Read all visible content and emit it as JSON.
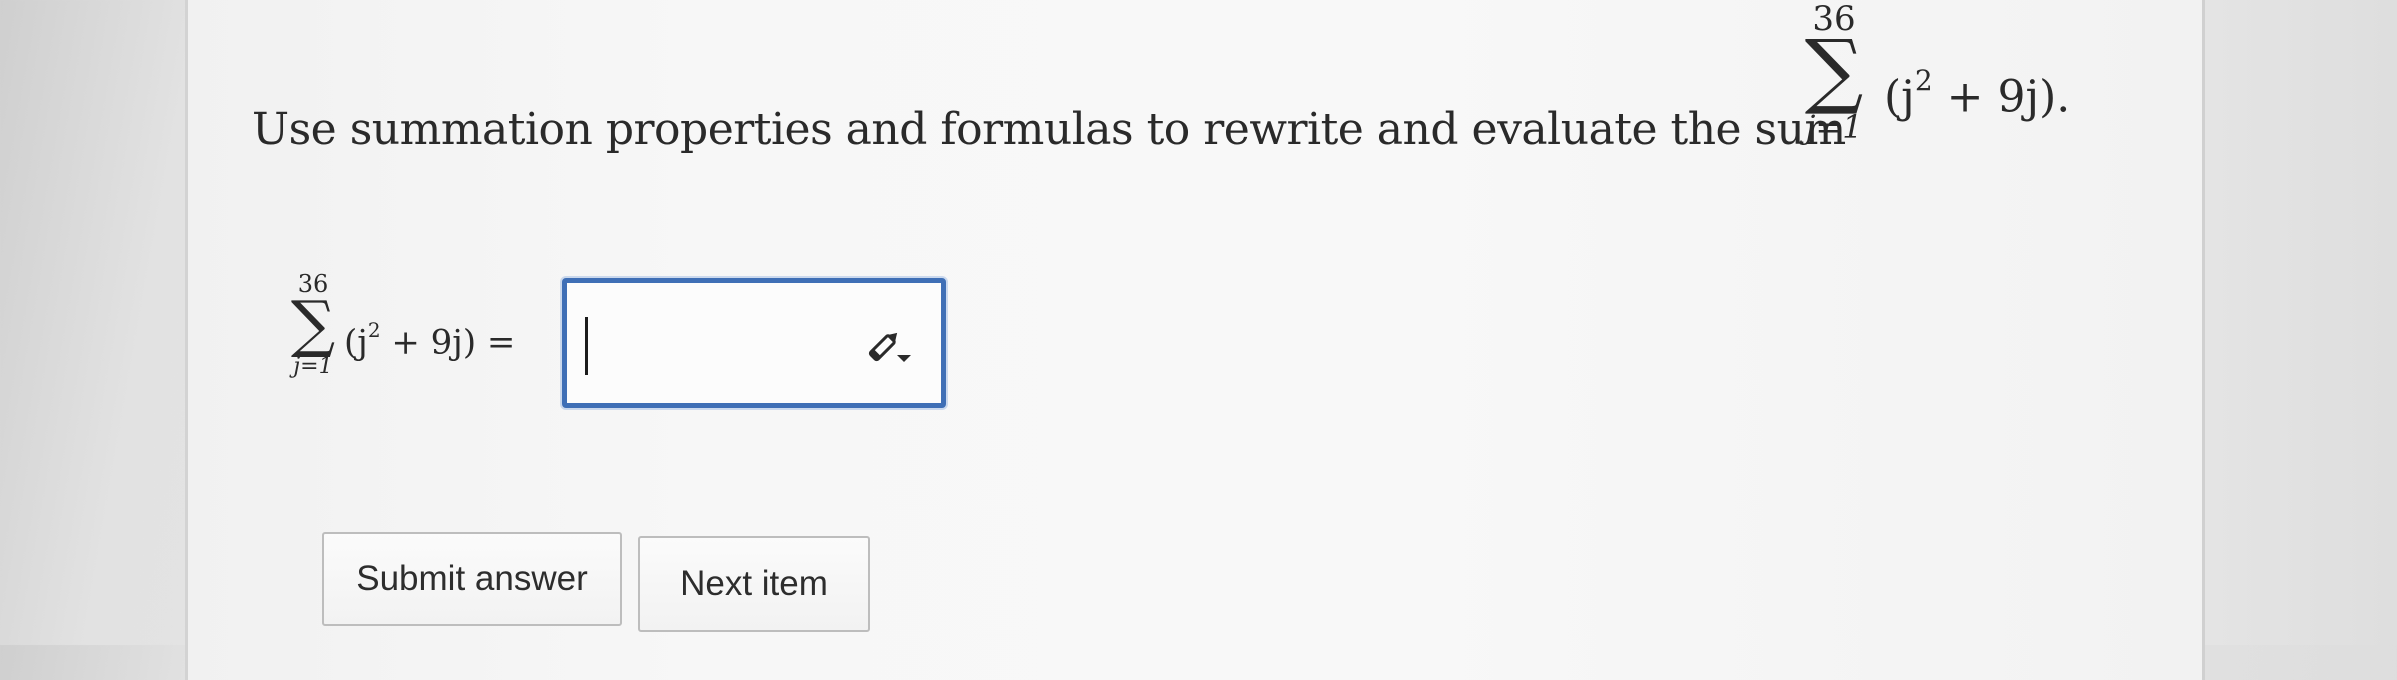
{
  "question": {
    "text": "Use summation properties and formulas to rewrite and evaluate the sum",
    "sum_upper": "36",
    "sum_symbol": "∑",
    "sum_lower": "j=1",
    "term_open": "(j",
    "term_exp": "2",
    "term_rest": " + 9j)."
  },
  "answer_line": {
    "sum_upper": "36",
    "sum_symbol": "∑",
    "sum_lower": "j=1",
    "term_open": "(j",
    "term_exp": "2",
    "term_rest": " + 9j) =",
    "input_value": ""
  },
  "buttons": {
    "submit_label": "Submit answer",
    "next_label": "Next item"
  },
  "icons": {
    "answer_tool": "pencil-dropdown-icon"
  },
  "colors": {
    "input_border": "#3f6fb6",
    "text": "#2a2a2a"
  }
}
